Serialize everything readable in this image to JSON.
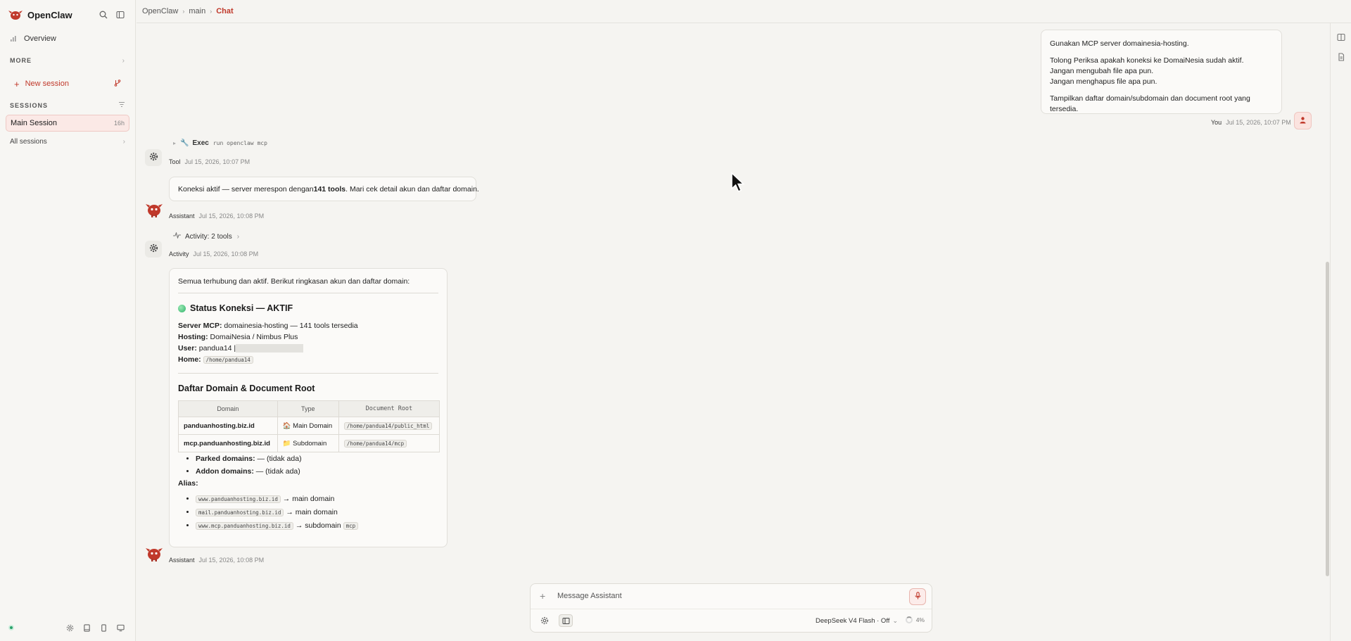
{
  "app": {
    "name": "OpenClaw"
  },
  "sidebar": {
    "overview_label": "Overview",
    "more_label": "MORE",
    "new_session_label": "New session",
    "sessions_label": "SESSIONS",
    "active_session": {
      "name": "Main Session",
      "age": "16h"
    },
    "all_sessions_label": "All sessions",
    "status_color": "#2ba26b"
  },
  "breadcrumb": {
    "items": [
      "OpenClaw",
      "main",
      "Chat"
    ]
  },
  "messages": {
    "user": {
      "lines": [
        "Gunakan MCP server domainesia-hosting.",
        "Tolong Periksa apakah koneksi ke DomaiNesia sudah aktif.",
        "Jangan mengubah file apa pun.",
        "Jangan menghapus file apa pun.",
        "Tampilkan daftar domain/subdomain dan document root yang tersedia."
      ],
      "author": "You",
      "time": "Jul 15, 2026, 10:07 PM"
    },
    "tool": {
      "verb": "Exec",
      "command": "run openclaw mcp",
      "author": "Tool",
      "time": "Jul 15, 2026, 10:07 PM"
    },
    "assistant_1": {
      "text_before": "Koneksi aktif — server merespon dengan ",
      "text_bold": "141 tools",
      "text_after": ". Mari cek detail akun dan daftar domain.",
      "author": "Assistant",
      "time": "Jul 15, 2026, 10:08 PM"
    },
    "activity": {
      "label": "Activity: 2 tools",
      "author": "Activity",
      "time": "Jul 15, 2026, 10:08 PM"
    },
    "assistant_2": {
      "intro": "Semua terhubung dan aktif. Berikut ringkasan akun dan daftar domain:",
      "status_heading": "Status Koneksi — AKTIF",
      "kv": [
        {
          "key": "Server MCP:",
          "value": " domainesia-hosting — 141 tools tersedia"
        },
        {
          "key": "Hosting:",
          "value": " DomaiNesia / Nimbus Plus"
        },
        {
          "key": "User:",
          "value": " pandua14 |"
        },
        {
          "key": "Home:",
          "value": "/home/pandua14"
        }
      ],
      "domain_heading": "Daftar Domain & Document Root",
      "table": {
        "headers": [
          "Domain",
          "Type",
          "Document Root"
        ],
        "rows": [
          {
            "domain": "panduanhosting.biz.id",
            "type_icon": "🏠",
            "type": "Main Domain",
            "root": "/home/pandua14/public_html"
          },
          {
            "domain": "mcp.panduanhosting.biz.id",
            "type_icon": "📁",
            "type": "Subdomain",
            "root": "/home/pandua14/mcp"
          }
        ]
      },
      "extra": [
        {
          "key": "Parked domains:",
          "value": " — (tidak ada)"
        },
        {
          "key": "Addon domains:",
          "value": " — (tidak ada)"
        }
      ],
      "alias_label": "Alias:",
      "aliases": [
        {
          "host": "www.panduanhosting.biz.id",
          "target": " → main domain",
          "chip": ""
        },
        {
          "host": "mail.panduanhosting.biz.id",
          "target": " → main domain",
          "chip": ""
        },
        {
          "host": "www.mcp.panduanhosting.biz.id",
          "target": " → subdomain ",
          "chip": "mcp"
        }
      ],
      "author": "Assistant",
      "time": "Jul 15, 2026, 10:08 PM"
    }
  },
  "composer": {
    "placeholder": "Message Assistant",
    "model": "DeepSeek V4 Flash · Off",
    "usage": "4%"
  },
  "colors": {
    "accent": "#c0392b",
    "background": "#f5f4f1"
  }
}
